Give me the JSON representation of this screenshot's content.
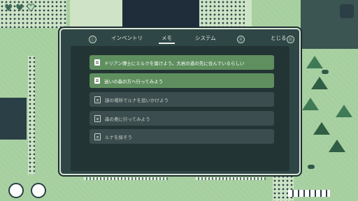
{
  "hud": {
    "hearts": [
      {
        "state": "full",
        "glyph": "♥"
      },
      {
        "state": "full",
        "glyph": "♥"
      },
      {
        "state": "empty",
        "glyph": "♥"
      }
    ]
  },
  "menu": {
    "left_button_glyph": "Ⓛ",
    "tabs": [
      {
        "label": "インベントリ",
        "active": false
      },
      {
        "label": "メモ",
        "active": true
      },
      {
        "label": "システム",
        "active": false
      }
    ],
    "right_button_glyph": "Ⓡ",
    "close_label": "とじる",
    "close_button_glyph": "Ⓑ",
    "memos": [
      {
        "text": "ドリアン博士にミルクを届けよう。大岩の道の先に住んでいるらしい",
        "highlighted": true
      },
      {
        "text": "迷いの森の方へ行ってみよう",
        "highlighted": true
      },
      {
        "text": "謎の場所でルナを追いかけよう",
        "highlighted": false
      },
      {
        "text": "森の奥に行ってみよう",
        "highlighted": false
      },
      {
        "text": "ルナを探そう",
        "highlighted": false
      }
    ]
  },
  "colors": {
    "panel_bg": "#2f4646",
    "highlight_row": "#5f8f5f",
    "normal_row": "#3c4d4f",
    "grass": "#a6cf9f"
  }
}
